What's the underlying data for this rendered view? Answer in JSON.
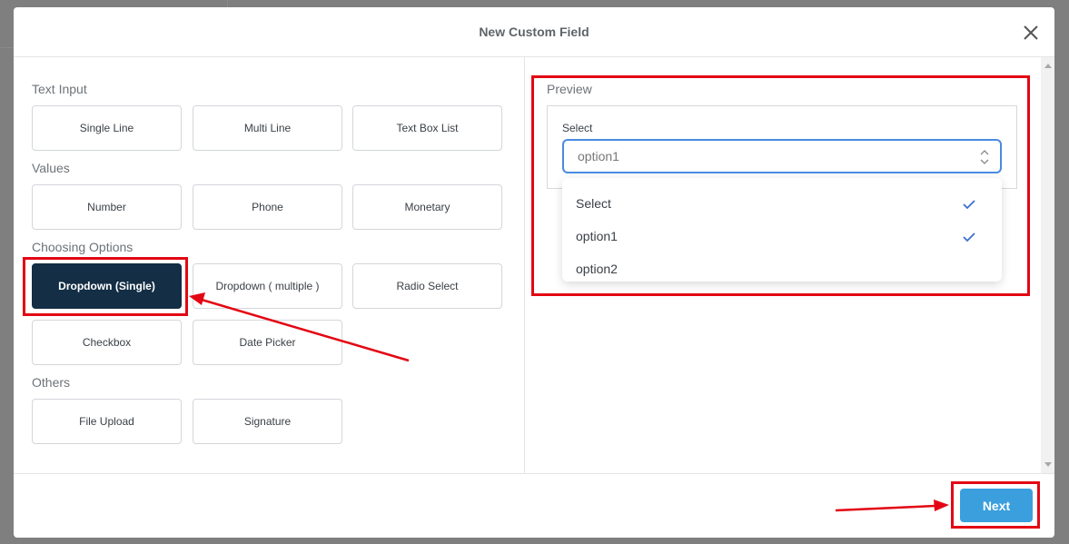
{
  "modal": {
    "title": "New Custom Field",
    "close_icon": "close-icon"
  },
  "sections": [
    {
      "label": "Text Input",
      "options": [
        "Single Line",
        "Multi Line",
        "Text Box List"
      ]
    },
    {
      "label": "Values",
      "options": [
        "Number",
        "Phone",
        "Monetary"
      ]
    },
    {
      "label": "Choosing Options",
      "options": [
        "Dropdown (Single)",
        "Dropdown ( multiple )",
        "Radio Select",
        "Checkbox",
        "Date Picker"
      ]
    },
    {
      "label": "Others",
      "options": [
        "File Upload",
        "Signature"
      ]
    }
  ],
  "selected_option": "Dropdown (Single)",
  "preview": {
    "label": "Preview",
    "select_label": "Select",
    "select_value": "option1",
    "dropdown_options": [
      {
        "label": "Select",
        "checked": true
      },
      {
        "label": "option1",
        "checked": true
      },
      {
        "label": "option2",
        "checked": false
      }
    ]
  },
  "footer": {
    "next_label": "Next"
  },
  "colors": {
    "active": "#132e45",
    "primary": "#3a9fdc",
    "focus": "#4a8be0",
    "annotation": "#e30613"
  }
}
